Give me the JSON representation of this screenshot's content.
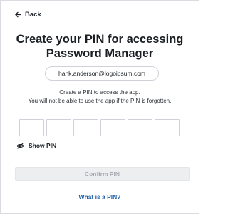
{
  "nav": {
    "back_label": "Back",
    "back_icon": "arrow-left-icon"
  },
  "header": {
    "title_line1": "Create your PIN for accessing",
    "title_line2": "Password Manager"
  },
  "account": {
    "email": "hank.anderson@logoipsum.com"
  },
  "description": {
    "line1": "Create a PIN to access the app.",
    "line2": "You will not be able to use the app if the PIN is forgotten."
  },
  "pin": {
    "length": 6,
    "digits": [
      "",
      "",
      "",
      "",
      "",
      ""
    ]
  },
  "show_pin": {
    "label": "Show PIN",
    "icon": "eye-off-icon"
  },
  "actions": {
    "confirm_label": "Confirm PIN",
    "confirm_disabled": true
  },
  "help": {
    "link_label": "What is a PIN?"
  },
  "colors": {
    "link": "#1f5fa8",
    "disabled_bg": "#edeef0",
    "disabled_text": "#a6abb2",
    "border": "#cfd3d9"
  }
}
